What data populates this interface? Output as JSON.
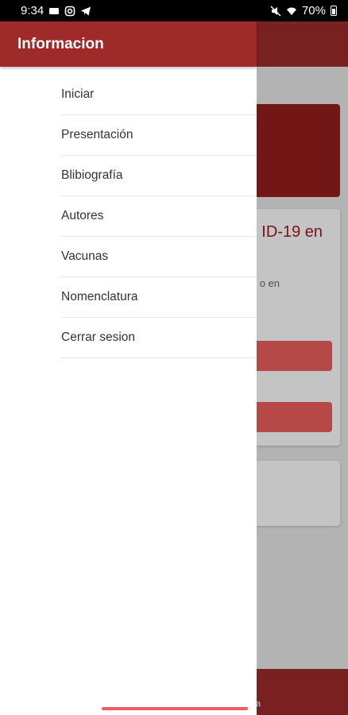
{
  "status_bar": {
    "time": "9:34",
    "battery": "70%"
  },
  "background_app": {
    "card_title": "ID-19 en",
    "card_subtitle": "o en",
    "footer_text": "a"
  },
  "drawer": {
    "title": "Informacion",
    "menu": [
      {
        "label": "Iniciar"
      },
      {
        "label": "Presentación"
      },
      {
        "label": "Blibiografía"
      },
      {
        "label": "Autores"
      },
      {
        "label": "Vacunas"
      },
      {
        "label": "Nomenclatura"
      },
      {
        "label": "Cerrar sesion"
      }
    ]
  },
  "colors": {
    "primary": "#9e2a2a",
    "accent": "#ef5e5e"
  }
}
